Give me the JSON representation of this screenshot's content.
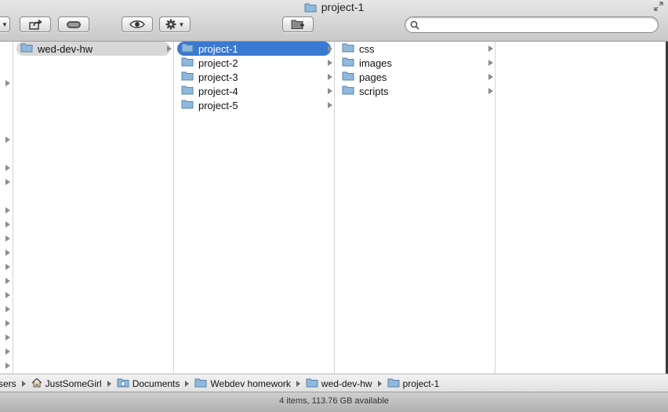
{
  "window": {
    "title": "project-1"
  },
  "search": {
    "value": "",
    "placeholder": ""
  },
  "columns": [
    {
      "items": [
        {
          "label": "wed-dev-hw",
          "state": "parent",
          "has_children": true
        }
      ]
    },
    {
      "items": [
        {
          "label": "project-1",
          "state": "selected",
          "has_children": true
        },
        {
          "label": "project-2",
          "state": "normal",
          "has_children": true
        },
        {
          "label": "project-3",
          "state": "normal",
          "has_children": true
        },
        {
          "label": "project-4",
          "state": "normal",
          "has_children": true
        },
        {
          "label": "project-5",
          "state": "normal",
          "has_children": true
        }
      ]
    },
    {
      "items": [
        {
          "label": "css",
          "state": "normal",
          "has_children": true
        },
        {
          "label": "images",
          "state": "normal",
          "has_children": true
        },
        {
          "label": "pages",
          "state": "normal",
          "has_children": true
        },
        {
          "label": "scripts",
          "state": "normal",
          "has_children": true
        }
      ]
    }
  ],
  "pathbar": {
    "crumbs": [
      {
        "label": "sers",
        "icon": "none"
      },
      {
        "label": "JustSomeGirl",
        "icon": "home-icon"
      },
      {
        "label": "Documents",
        "icon": "documents-folder-icon"
      },
      {
        "label": "Webdev homework",
        "icon": "folder-icon"
      },
      {
        "label": "wed-dev-hw",
        "icon": "folder-icon"
      },
      {
        "label": "project-1",
        "icon": "folder-icon"
      }
    ]
  },
  "status": {
    "text": "4 items, 113.76 GB available"
  },
  "colors": {
    "selection": "#3a79d2",
    "folder": "#8fb8dc",
    "toolbar": "#d4d4d4"
  }
}
